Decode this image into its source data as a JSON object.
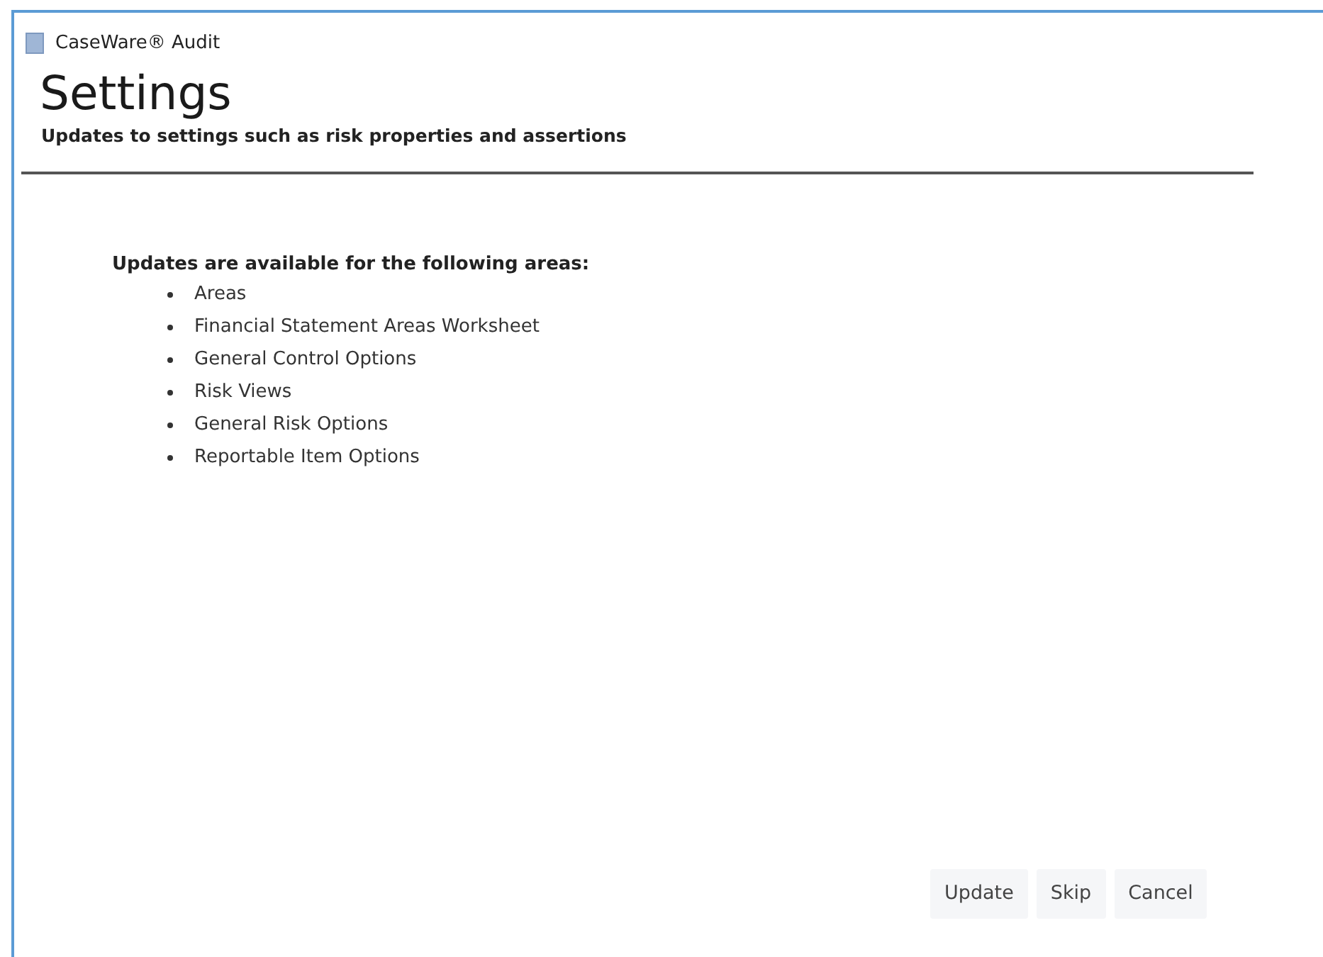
{
  "window": {
    "title": "CaseWare® Audit"
  },
  "header": {
    "title": "Settings",
    "subtitle": "Updates to settings such as risk properties and assertions"
  },
  "updates": {
    "heading": "Updates are available for the following areas:",
    "items": [
      "Areas",
      "Financial Statement Areas Worksheet",
      "General Control Options",
      "Risk Views",
      "General Risk Options",
      "Reportable Item Options"
    ]
  },
  "buttons": [
    "Update",
    "Skip",
    "Cancel"
  ]
}
